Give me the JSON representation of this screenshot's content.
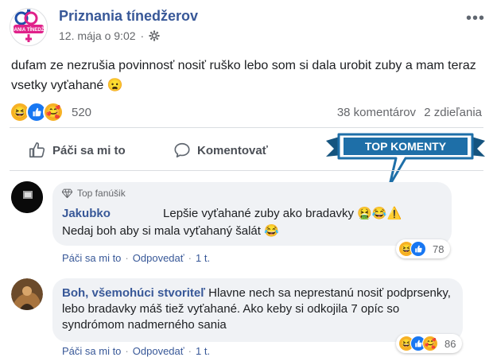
{
  "post": {
    "page_name": "Priznania tínedžerov",
    "date": "12. mája o 9:02",
    "text": "dufam ze nezrušia povinnosť nosiť ruško lebo som si dala urobit zuby a mam teraz vsetky vyťahané 😦",
    "logo_text": "PRIZNANIA TÍNEDŽEROV",
    "reaction_count": "520",
    "comments_count": "38 komentárov",
    "shares_count": "2 zdieľania"
  },
  "actions": {
    "like": "Páči sa mi to",
    "comment": "Komentovať"
  },
  "badge": {
    "text": "TOP KOMENTY"
  },
  "comments": [
    {
      "badge": "Top fanúšik",
      "author": "Jakubko",
      "line1": "Lepšie vyťahané zuby ako bradavky 🤮😂⚠️",
      "line2": "Nedaj boh aby si mala vyťahaný šalát 😂",
      "like": "Páči sa mi to",
      "reply": "Odpovedať",
      "time": "1 t.",
      "reactions": "78"
    },
    {
      "author": "Boh, všemohúci stvoriteľ",
      "text": "Hlavne nech sa neprestanú nosiť podprsenky, lebo bradavky máš tiež vyťahané. Ako keby si odkojila 7 opíc so syndrómom nadmerného sania",
      "like": "Páči sa mi to",
      "reply": "Odpovedať",
      "time": "1 t.",
      "reactions": "86"
    }
  ],
  "colors": {
    "link": "#385898",
    "bubble": "#f0f2f5",
    "badge": "#1e6fa8",
    "like_blue": "#1877f2"
  }
}
